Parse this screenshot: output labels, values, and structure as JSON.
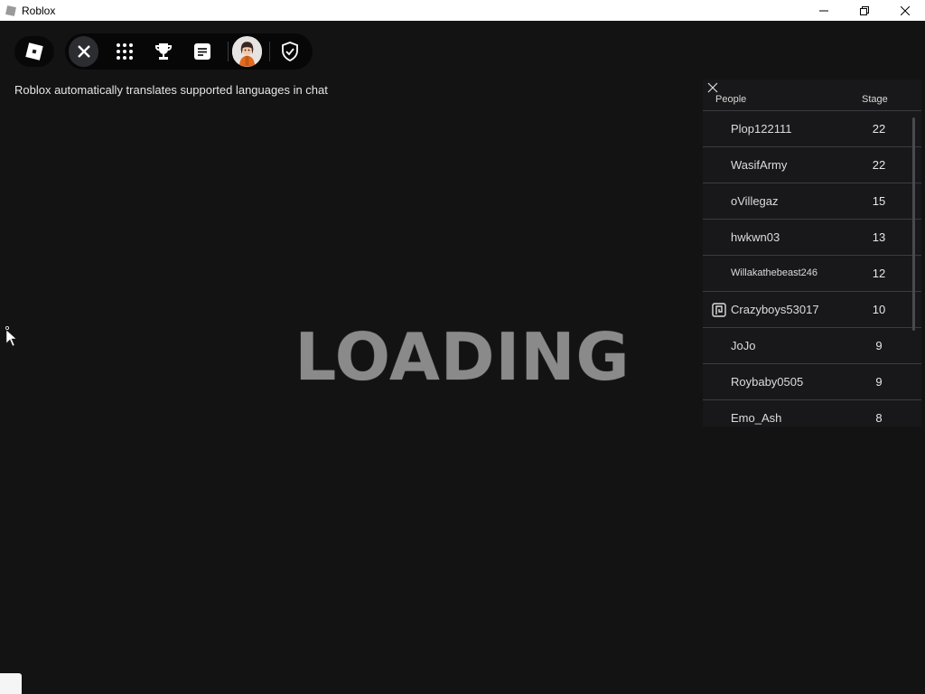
{
  "window": {
    "title": "Roblox"
  },
  "toolbar": {
    "items": [
      {
        "icon": "roblox-logo-icon"
      },
      {
        "icon": "close-icon"
      },
      {
        "icon": "grid-icon"
      },
      {
        "icon": "trophy-icon"
      },
      {
        "icon": "chat-icon"
      },
      {
        "icon": "avatar-icon"
      },
      {
        "icon": "shield-check-icon"
      }
    ]
  },
  "chat_note": "Roblox automatically translates supported languages in chat",
  "loading_text": "LOADING",
  "leaderboard": {
    "header_people": "People",
    "header_stage": "Stage",
    "rows": [
      {
        "name": "Plop122111",
        "stage": "22"
      },
      {
        "name": "WasifArmy",
        "stage": "22"
      },
      {
        "name": "oVillegaz",
        "stage": "15"
      },
      {
        "name": "hwkwn03",
        "stage": "13"
      },
      {
        "name": "Willakathebeast246",
        "stage": "12"
      },
      {
        "name": "Crazyboys53017",
        "stage": "10"
      },
      {
        "name": "JoJo",
        "stage": "9"
      },
      {
        "name": "Roybaby0505",
        "stage": "9"
      },
      {
        "name": "Emo_Ash",
        "stage": "8"
      }
    ]
  },
  "colors": {
    "background": "#131314",
    "loading": "#8a8a8a",
    "text": "#e6e6e6"
  }
}
